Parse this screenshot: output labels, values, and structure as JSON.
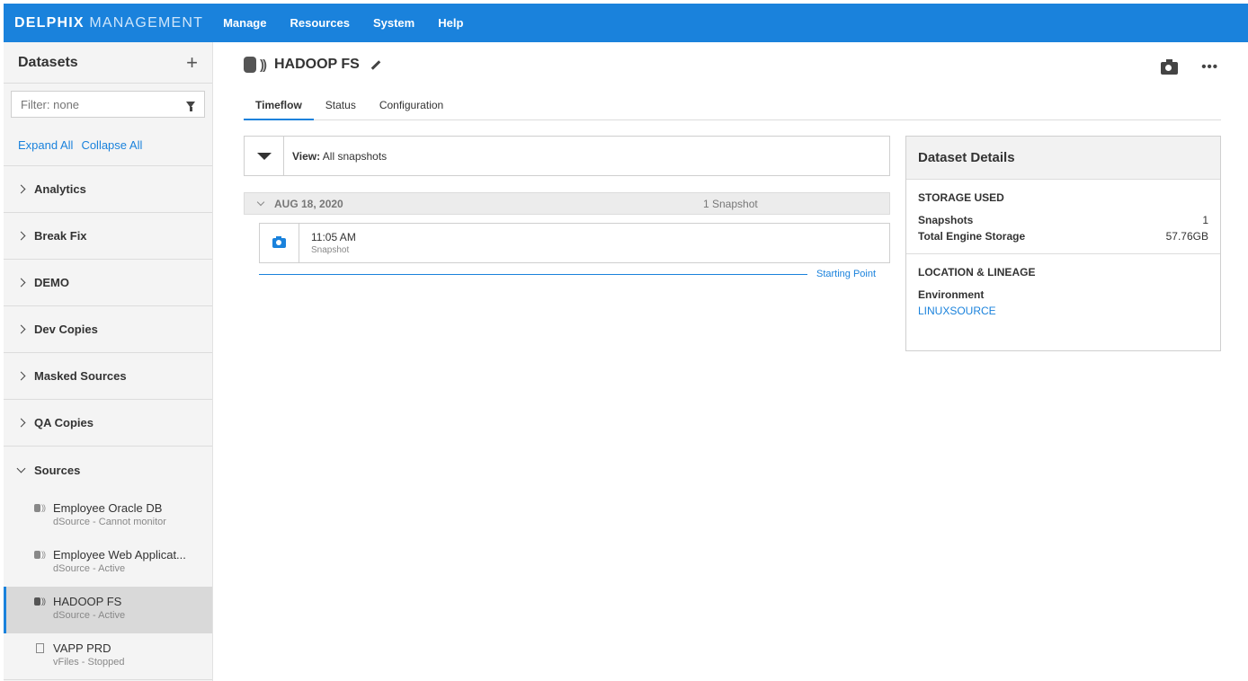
{
  "brand": {
    "strong": "DELPHIX",
    "light": "MANAGEMENT"
  },
  "nav": [
    "Manage",
    "Resources",
    "System",
    "Help"
  ],
  "sidebar": {
    "title": "Datasets",
    "add_label": "+",
    "filter_placeholder": "Filter: none",
    "expand_all": "Expand All",
    "collapse_all": "Collapse All",
    "groups": [
      "Analytics",
      "Break Fix",
      "DEMO",
      "Dev Copies",
      "Masked Sources",
      "QA Copies",
      "Sources"
    ],
    "sources": [
      {
        "name": "Employee Oracle DB",
        "sub": "dSource - Cannot monitor"
      },
      {
        "name": "Employee Web Applicat...",
        "sub": "dSource - Active"
      },
      {
        "name": "HADOOP FS",
        "sub": "dSource - Active"
      },
      {
        "name": "VAPP PRD",
        "sub": "vFiles - Stopped"
      }
    ]
  },
  "main": {
    "title": "HADOOP FS",
    "tabs": [
      "Timeflow",
      "Status",
      "Configuration"
    ],
    "view_label": "View:",
    "view_value": "All snapshots",
    "date": "AUG 18, 2020",
    "snapshot_count": "1 Snapshot",
    "snapshot_time": "11:05 AM",
    "snapshot_type": "Snapshot",
    "starting_point": "Starting Point",
    "more_label": "•••"
  },
  "details": {
    "title": "Dataset Details",
    "storage_title": "STORAGE USED",
    "snapshots_label": "Snapshots",
    "snapshots_value": "1",
    "storage_label": "Total Engine Storage",
    "storage_value": "57.76GB",
    "location_title": "LOCATION & LINEAGE",
    "environment_label": "Environment",
    "environment_value": "LINUXSOURCE"
  },
  "colors": {
    "accent": "#1a82dc"
  },
  "icons": [
    "filter-icon",
    "pencil-icon",
    "camera-icon",
    "more-icon",
    "database-icon",
    "file-icon"
  ]
}
